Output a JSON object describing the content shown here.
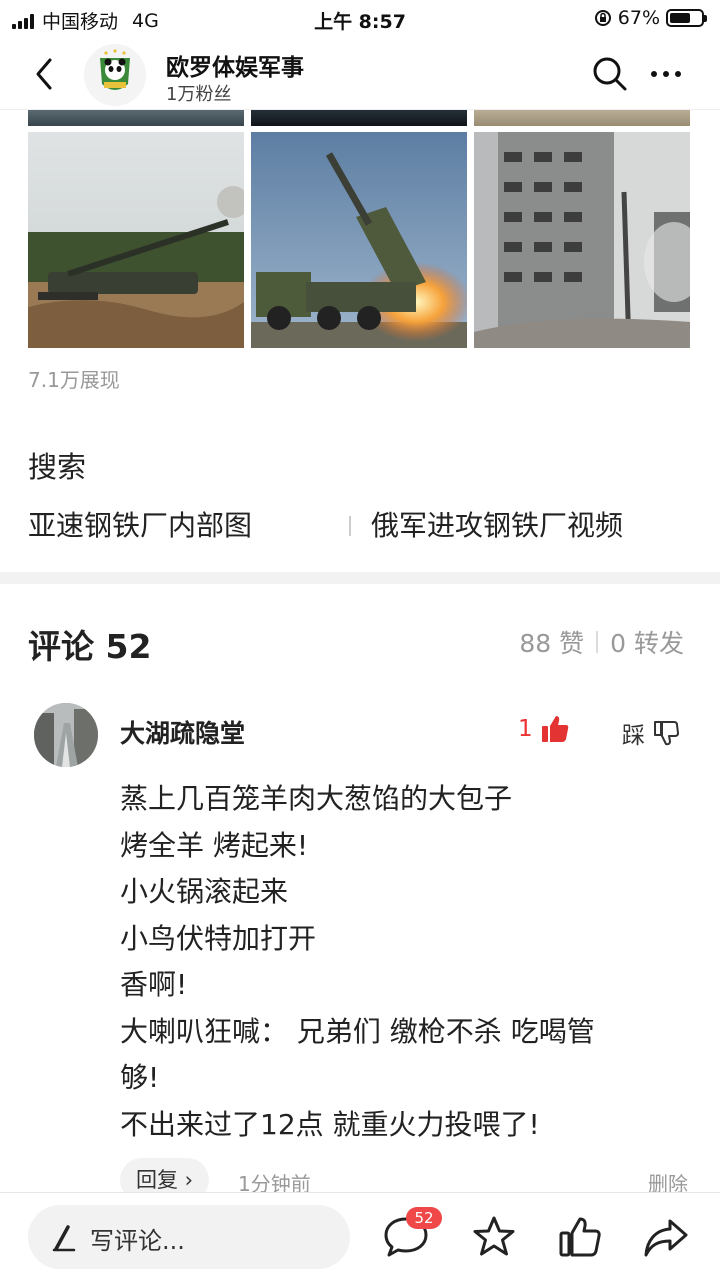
{
  "status_bar": {
    "carrier": "中国移动",
    "network": "4G",
    "time": "上午 8:57",
    "battery": "67%",
    "battery_level": 0.67
  },
  "header": {
    "account_name": "欧罗体娱军事",
    "followers": "1万粉丝"
  },
  "post": {
    "images": [
      {
        "icon": "artillery-photo"
      },
      {
        "icon": "rocket-launcher-photo"
      },
      {
        "icon": "damaged-building-photo"
      }
    ],
    "views": "7.1万展现"
  },
  "search": {
    "label": "搜索",
    "items": [
      "亚速钢铁厂内部图",
      "俄军进攻钢铁厂视频"
    ]
  },
  "comments": {
    "header": "评论 52",
    "likes": "88 赞",
    "shares": "0 转发",
    "items": [
      {
        "author": "大湖疏隐堂",
        "like_count": "1",
        "dislike_label": "踩",
        "lines": [
          "蒸上几百笼羊肉大葱馅的大包子",
          "烤全羊 烤起来!",
          "小火锅滚起来",
          "小鸟伏特加打开",
          "香啊!",
          "大喇叭狂喊： 兄弟们 缴枪不杀 吃喝管",
          "够!",
          "不出来过了12点 就重火力投喂了!"
        ],
        "reply_label": "回复 ›",
        "time": "1分钟前",
        "delete_label": "删除"
      }
    ]
  },
  "bottom_bar": {
    "write_placeholder": "写评论...",
    "comment_badge": "52"
  },
  "colors": {
    "accent_red": "#e33333",
    "badge_red": "#f04848",
    "muted_text": "#999999"
  }
}
